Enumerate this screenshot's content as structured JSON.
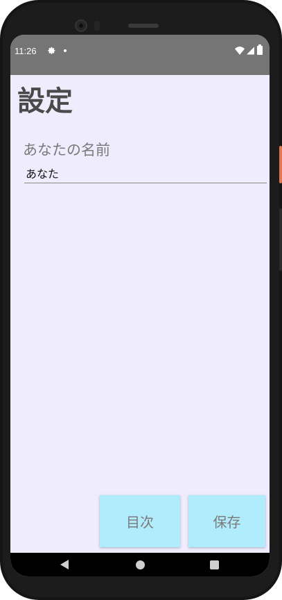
{
  "status_bar": {
    "time": "11:26",
    "icons": [
      "gear-icon",
      "notification-dot-icon",
      "wifi-icon",
      "signal-icon",
      "battery-icon"
    ]
  },
  "page": {
    "title": "設定"
  },
  "name_field": {
    "label": "あなたの名前",
    "value": "あなた"
  },
  "buttons": {
    "contents_label": "目次",
    "save_label": "保存"
  },
  "nav_bar": {
    "icons": [
      "back-icon",
      "home-icon",
      "recents-icon"
    ]
  },
  "colors": {
    "background": "#efedfd",
    "status_bar": "#757575",
    "button": "#b0ecfb",
    "button_text": "#7a7a7a"
  }
}
